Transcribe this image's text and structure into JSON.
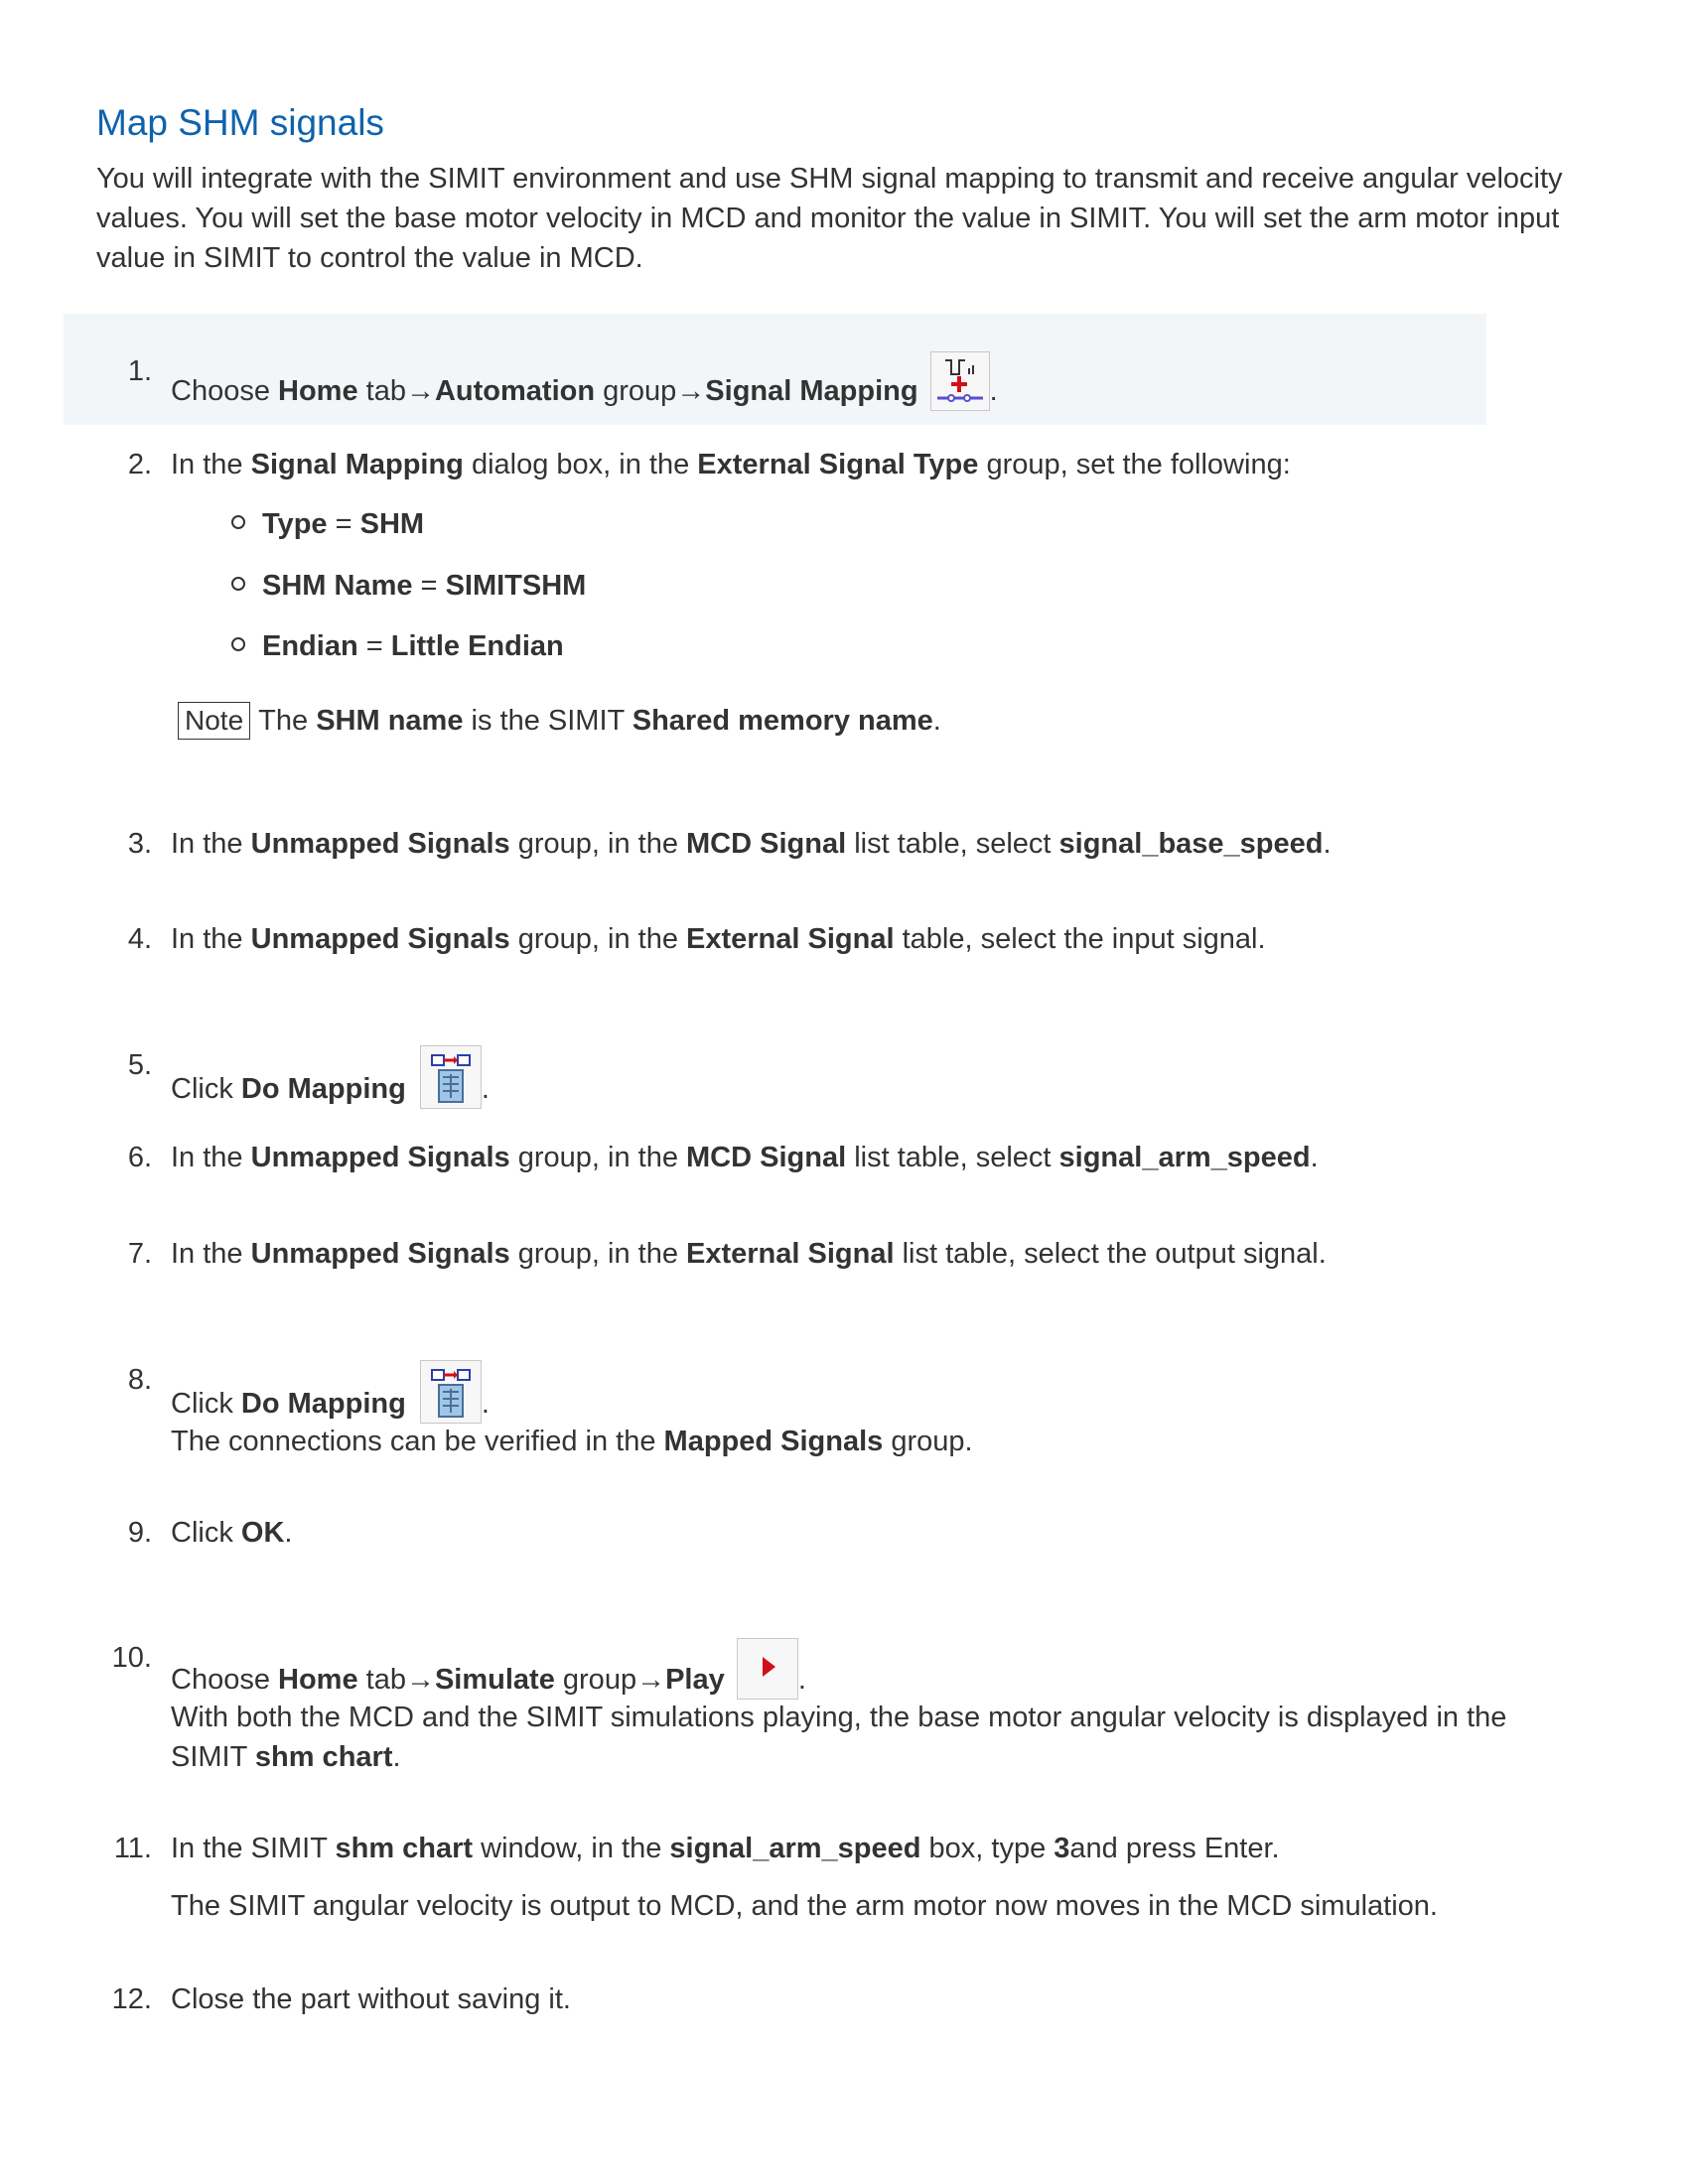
{
  "title": "Map SHM signals",
  "intro": "You will integrate with the SIMIT environment and use SHM signal mapping to transmit and receive angular velocity values. You will set the base motor velocity in MCD and monitor the value in SIMIT. You will set the arm motor input value in SIMIT to control the value in MCD.",
  "steps": {
    "s1": {
      "num": "1.",
      "t1": "Choose ",
      "b1": "Home",
      "t2": " tab→",
      "b2": "Automation",
      "t3": " group→",
      "b3": "Signal Mapping",
      "t4": ".",
      "icon": "signal-mapping-icon"
    },
    "s2": {
      "num": "2.",
      "t1": "In the ",
      "b1": "Signal Mapping",
      "t2": " dialog box, in the ",
      "b2": "External Signal Type",
      "t3": " group, set the following:",
      "items": [
        {
          "k": "Type",
          "eq": " = ",
          "v": "SHM"
        },
        {
          "k": "SHM Name",
          "eq": " = ",
          "v": "SIMITSHM"
        },
        {
          "k": "Endian",
          "eq": " = ",
          "v": "Little Endian"
        }
      ],
      "note": {
        "tag": "Note",
        "t1": "The ",
        "b1": "SHM name",
        "t2": " is the SIMIT ",
        "b2": "Shared memory name",
        "t3": "."
      }
    },
    "s3": {
      "num": "3.",
      "t1": "In the ",
      "b1": "Unmapped Signals",
      "t2": " group, in the ",
      "b2": "MCD Signal",
      "t3": " list table, select ",
      "b3": "signal_base_speed",
      "t4": "."
    },
    "s4": {
      "num": "4.",
      "t1": "In the ",
      "b1": "Unmapped Signals",
      "t2": " group, in the ",
      "b2": "External Signal",
      "t3": " table, select the input signal."
    },
    "s5": {
      "num": "5.",
      "t1": "Click ",
      "b1": "Do Mapping",
      "t2": ".",
      "icon": "do-mapping-icon"
    },
    "s6": {
      "num": "6.",
      "t1": "In the ",
      "b1": "Unmapped Signals",
      "t2": " group, in the ",
      "b2": "MCD Signal",
      "t3": " list table, select ",
      "b3": "signal_arm_speed",
      "t4": "."
    },
    "s7": {
      "num": "7.",
      "t1": "In the ",
      "b1": "Unmapped Signals",
      "t2": " group, in the ",
      "b2": "External Signal",
      "t3": " list table, select the output signal."
    },
    "s8": {
      "num": "8.",
      "t1": "Click ",
      "b1": "Do Mapping",
      "t2": ".",
      "icon": "do-mapping-icon",
      "result": {
        "t1": "The connections can be verified in the ",
        "b1": "Mapped Signals",
        "t2": " group."
      }
    },
    "s9": {
      "num": "9.",
      "t1": "Click ",
      "b1": "OK",
      "t2": "."
    },
    "s10": {
      "num": "10.",
      "t1": "Choose ",
      "b1": "Home",
      "t2": " tab→",
      "b2": "Simulate",
      "t3": " group→",
      "b3": "Play",
      "t4": ".",
      "icon": "play-icon",
      "result": {
        "t1": "With both the MCD and the SIMIT simulations playing, the base motor angular velocity is displayed in the SIMIT ",
        "b1": "shm chart",
        "t2": "."
      }
    },
    "s11": {
      "num": "11.",
      "t1": "In the SIMIT ",
      "b1": "shm chart",
      "t2": " window, in the ",
      "b2": "signal_arm_speed",
      "t3": " box, type ",
      "b3": "3",
      "t4": "and press Enter.",
      "result": "The SIMIT angular velocity is output to MCD, and the arm motor now moves in the MCD simulation."
    },
    "s12": {
      "num": "12.",
      "t1": "Close the part without saving it."
    }
  },
  "colors": {
    "title": "#0f62ad",
    "text": "#333333",
    "highlight": "#f2f6f8",
    "play_red": "#d0101a"
  }
}
